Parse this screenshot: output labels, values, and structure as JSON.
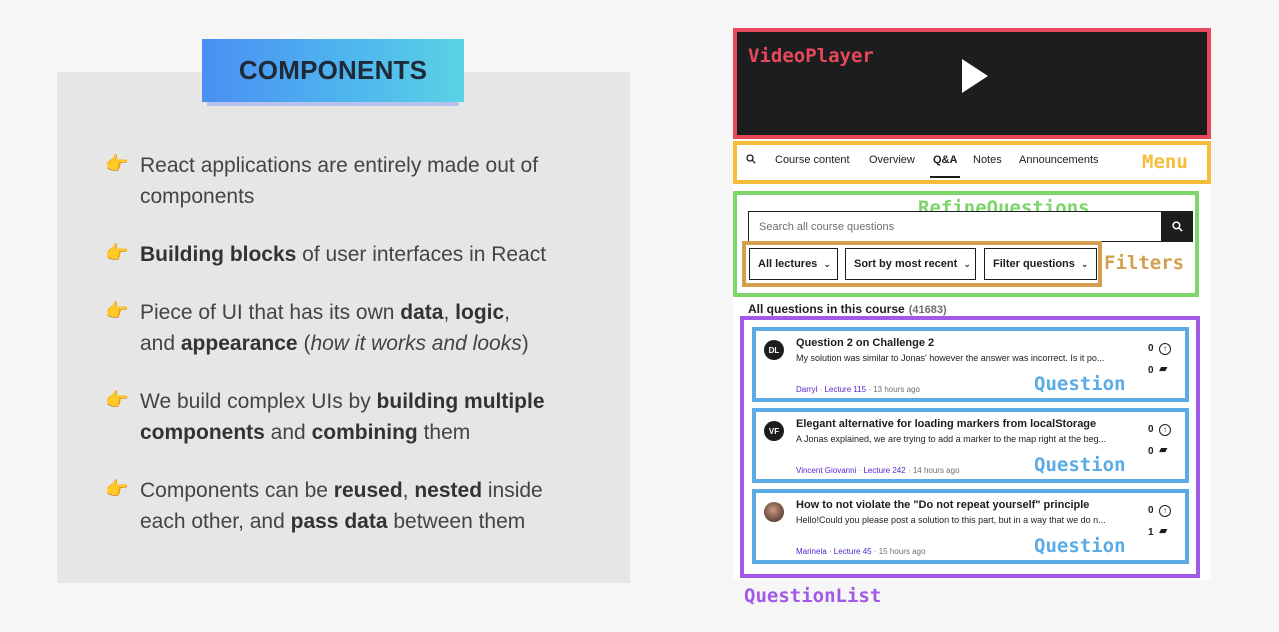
{
  "colors": {
    "video_border": "#e8485c",
    "menu_border": "#f5bd3a",
    "refine_border": "#7ed56b",
    "filters_border": "#d4a04f",
    "question_list_border": "#a259e6",
    "question_border": "#5aabe6",
    "title_gradient": [
      "#4a8ff2",
      "#5ad3e3"
    ],
    "bullet_icon": "#f2a51e"
  },
  "slide": {
    "title": "COMPONENTS",
    "bullet_icon": "point-right-hand-icon",
    "bullets": [
      {
        "line1": "React applications are entirely made out of",
        "line2": "components"
      },
      {
        "bold1": "Building blocks",
        "rest": " of user interfaces in React"
      },
      {
        "pre": "Piece of UI that has its own ",
        "b1": "data",
        "c1": ", ",
        "b2": "logic",
        "c2": ",",
        "and": "and ",
        "b3": "appearance",
        "paren_open": " (",
        "italic": "how it works and looks",
        "paren_close": ")"
      },
      {
        "pre": "We build complex UIs by ",
        "b1": "building multiple",
        "b2": "components",
        "mid": " and ",
        "b3": "combining",
        "post": " them"
      },
      {
        "pre": "Components can be ",
        "b1": "reused",
        "c1": ", ",
        "b2": "nested",
        "post1": " inside",
        "pre2": "each other, and ",
        "b3": "pass data",
        "post2": " between them"
      }
    ]
  },
  "labels": {
    "video_player": "VideoPlayer",
    "menu": "Menu",
    "refine": "RefineQuestions",
    "filters": "Filters",
    "question_list": "QuestionList"
  },
  "menu": {
    "search_icon": "search-icon",
    "items": [
      {
        "label": "Course content",
        "active": false
      },
      {
        "label": "Overview",
        "active": false
      },
      {
        "label": "Q&A",
        "active": true
      },
      {
        "label": "Notes",
        "active": false
      },
      {
        "label": "Announcements",
        "active": false
      }
    ]
  },
  "search": {
    "placeholder": "Search all course questions"
  },
  "filters": [
    {
      "label": "All lectures"
    },
    {
      "label": "Sort by most recent"
    },
    {
      "label": "Filter questions"
    }
  ],
  "question_list": {
    "heading": "All questions in this course",
    "count": "(41683)",
    "questions": [
      {
        "avatar": "DL",
        "title": "Question 2 on Challenge 2",
        "excerpt": "My solution was similar to Jonas' however the answer was incorrect. Is it po...",
        "author": "Darryl",
        "lecture": "Lecture 115",
        "time": "13 hours ago",
        "upvotes": "0",
        "replies": "0",
        "label": "Question"
      },
      {
        "avatar": "VF",
        "title": "Elegant alternative for loading markers from localStorage",
        "excerpt": "A Jonas explained, we are trying to add a marker to the map right at the beg...",
        "author": "Vincent Giovanni",
        "lecture": "Lecture 242",
        "time": "14 hours ago",
        "upvotes": "0",
        "replies": "0",
        "label": "Question"
      },
      {
        "avatar": "",
        "title": "How to not violate the \"Do not repeat yourself\" principle",
        "excerpt": "Hello!Could you please post a solution to this part, but in a way that we do n...",
        "author": "Marinela",
        "lecture": "Lecture 45",
        "time": "15 hours ago",
        "upvotes": "0",
        "replies": "1",
        "label": "Question"
      }
    ]
  },
  "meta_sep": " · "
}
